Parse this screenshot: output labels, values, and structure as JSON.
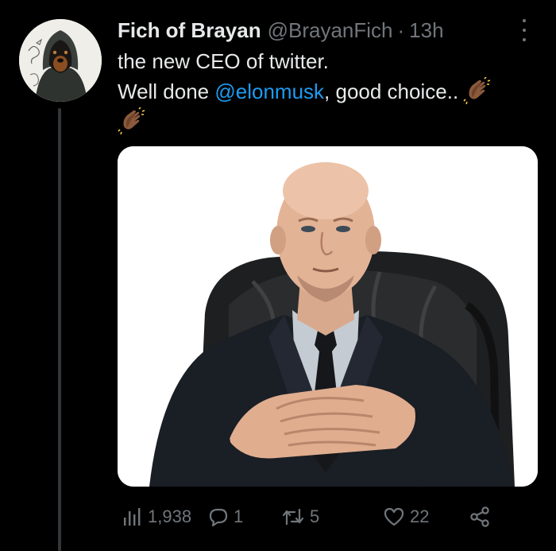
{
  "tweet": {
    "display_name": "Fich of Brayan",
    "handle": "@BrayanFich",
    "separator": "·",
    "time": "13h",
    "text_line1": "the new CEO of twitter.",
    "text_line2_prefix": "Well done ",
    "mention": "@elonmusk",
    "text_line2_suffix": ", good choice..",
    "emoji": "clapping-hands-icon"
  },
  "avatar": {
    "icon": "hooded-dog-avatar"
  },
  "media": {
    "description_icon": "man-in-suit-photo"
  },
  "actions": {
    "views": "1,938",
    "replies": "1",
    "retweets": "5",
    "likes": "22"
  },
  "colors": {
    "background": "#000000",
    "text": "#e7e9ea",
    "muted": "#71767b",
    "link": "#1d9bf0",
    "thread_line": "#333639"
  }
}
